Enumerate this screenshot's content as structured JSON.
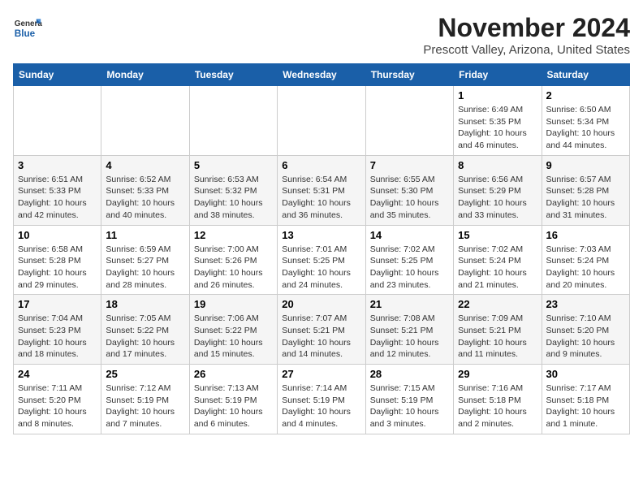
{
  "logo": {
    "general": "General",
    "blue": "Blue"
  },
  "title": "November 2024",
  "location": "Prescott Valley, Arizona, United States",
  "days_header": [
    "Sunday",
    "Monday",
    "Tuesday",
    "Wednesday",
    "Thursday",
    "Friday",
    "Saturday"
  ],
  "weeks": [
    [
      {
        "day": "",
        "info": ""
      },
      {
        "day": "",
        "info": ""
      },
      {
        "day": "",
        "info": ""
      },
      {
        "day": "",
        "info": ""
      },
      {
        "day": "",
        "info": ""
      },
      {
        "day": "1",
        "info": "Sunrise: 6:49 AM\nSunset: 5:35 PM\nDaylight: 10 hours and 46 minutes."
      },
      {
        "day": "2",
        "info": "Sunrise: 6:50 AM\nSunset: 5:34 PM\nDaylight: 10 hours and 44 minutes."
      }
    ],
    [
      {
        "day": "3",
        "info": "Sunrise: 6:51 AM\nSunset: 5:33 PM\nDaylight: 10 hours and 42 minutes."
      },
      {
        "day": "4",
        "info": "Sunrise: 6:52 AM\nSunset: 5:33 PM\nDaylight: 10 hours and 40 minutes."
      },
      {
        "day": "5",
        "info": "Sunrise: 6:53 AM\nSunset: 5:32 PM\nDaylight: 10 hours and 38 minutes."
      },
      {
        "day": "6",
        "info": "Sunrise: 6:54 AM\nSunset: 5:31 PM\nDaylight: 10 hours and 36 minutes."
      },
      {
        "day": "7",
        "info": "Sunrise: 6:55 AM\nSunset: 5:30 PM\nDaylight: 10 hours and 35 minutes."
      },
      {
        "day": "8",
        "info": "Sunrise: 6:56 AM\nSunset: 5:29 PM\nDaylight: 10 hours and 33 minutes."
      },
      {
        "day": "9",
        "info": "Sunrise: 6:57 AM\nSunset: 5:28 PM\nDaylight: 10 hours and 31 minutes."
      }
    ],
    [
      {
        "day": "10",
        "info": "Sunrise: 6:58 AM\nSunset: 5:28 PM\nDaylight: 10 hours and 29 minutes."
      },
      {
        "day": "11",
        "info": "Sunrise: 6:59 AM\nSunset: 5:27 PM\nDaylight: 10 hours and 28 minutes."
      },
      {
        "day": "12",
        "info": "Sunrise: 7:00 AM\nSunset: 5:26 PM\nDaylight: 10 hours and 26 minutes."
      },
      {
        "day": "13",
        "info": "Sunrise: 7:01 AM\nSunset: 5:25 PM\nDaylight: 10 hours and 24 minutes."
      },
      {
        "day": "14",
        "info": "Sunrise: 7:02 AM\nSunset: 5:25 PM\nDaylight: 10 hours and 23 minutes."
      },
      {
        "day": "15",
        "info": "Sunrise: 7:02 AM\nSunset: 5:24 PM\nDaylight: 10 hours and 21 minutes."
      },
      {
        "day": "16",
        "info": "Sunrise: 7:03 AM\nSunset: 5:24 PM\nDaylight: 10 hours and 20 minutes."
      }
    ],
    [
      {
        "day": "17",
        "info": "Sunrise: 7:04 AM\nSunset: 5:23 PM\nDaylight: 10 hours and 18 minutes."
      },
      {
        "day": "18",
        "info": "Sunrise: 7:05 AM\nSunset: 5:22 PM\nDaylight: 10 hours and 17 minutes."
      },
      {
        "day": "19",
        "info": "Sunrise: 7:06 AM\nSunset: 5:22 PM\nDaylight: 10 hours and 15 minutes."
      },
      {
        "day": "20",
        "info": "Sunrise: 7:07 AM\nSunset: 5:21 PM\nDaylight: 10 hours and 14 minutes."
      },
      {
        "day": "21",
        "info": "Sunrise: 7:08 AM\nSunset: 5:21 PM\nDaylight: 10 hours and 12 minutes."
      },
      {
        "day": "22",
        "info": "Sunrise: 7:09 AM\nSunset: 5:21 PM\nDaylight: 10 hours and 11 minutes."
      },
      {
        "day": "23",
        "info": "Sunrise: 7:10 AM\nSunset: 5:20 PM\nDaylight: 10 hours and 9 minutes."
      }
    ],
    [
      {
        "day": "24",
        "info": "Sunrise: 7:11 AM\nSunset: 5:20 PM\nDaylight: 10 hours and 8 minutes."
      },
      {
        "day": "25",
        "info": "Sunrise: 7:12 AM\nSunset: 5:19 PM\nDaylight: 10 hours and 7 minutes."
      },
      {
        "day": "26",
        "info": "Sunrise: 7:13 AM\nSunset: 5:19 PM\nDaylight: 10 hours and 6 minutes."
      },
      {
        "day": "27",
        "info": "Sunrise: 7:14 AM\nSunset: 5:19 PM\nDaylight: 10 hours and 4 minutes."
      },
      {
        "day": "28",
        "info": "Sunrise: 7:15 AM\nSunset: 5:19 PM\nDaylight: 10 hours and 3 minutes."
      },
      {
        "day": "29",
        "info": "Sunrise: 7:16 AM\nSunset: 5:18 PM\nDaylight: 10 hours and 2 minutes."
      },
      {
        "day": "30",
        "info": "Sunrise: 7:17 AM\nSunset: 5:18 PM\nDaylight: 10 hours and 1 minute."
      }
    ]
  ]
}
